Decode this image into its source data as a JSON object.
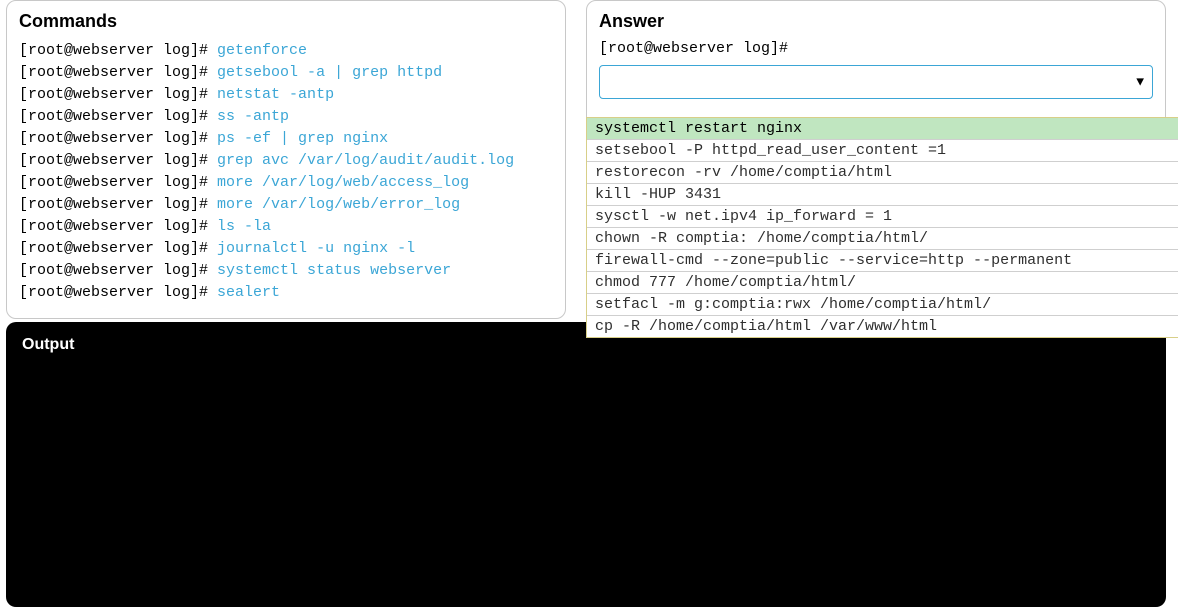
{
  "commands": {
    "title": "Commands",
    "prompt": "[root@webserver log]# ",
    "items": [
      "getenforce",
      "getsebool -a | grep httpd",
      "netstat -antp",
      "ss -antp",
      "ps -ef | grep nginx",
      "grep avc /var/log/audit/audit.log",
      "more /var/log/web/access_log",
      "more /var/log/web/error_log",
      "ls -la",
      "journalctl -u nginx -l",
      "systemctl status webserver",
      "sealert"
    ]
  },
  "answer": {
    "title": "Answer",
    "prompt": "[root@webserver log]#",
    "select_arrow": "▼",
    "highlight_index": 0,
    "options": [
      "systemctl restart nginx",
      "setsebool -P httpd_read_user_content =1",
      "restorecon -rv /home/comptia/html",
      "kill -HUP 3431",
      "sysctl -w net.ipv4 ip_forward = 1",
      "chown -R comptia: /home/comptia/html/",
      "firewall-cmd --zone=public --service=http --permanent",
      "chmod 777 /home/comptia/html/",
      "setfacl -m g:comptia:rwx /home/comptia/html/",
      "cp -R /home/comptia/html /var/www/html"
    ]
  },
  "output": {
    "title": "Output"
  }
}
